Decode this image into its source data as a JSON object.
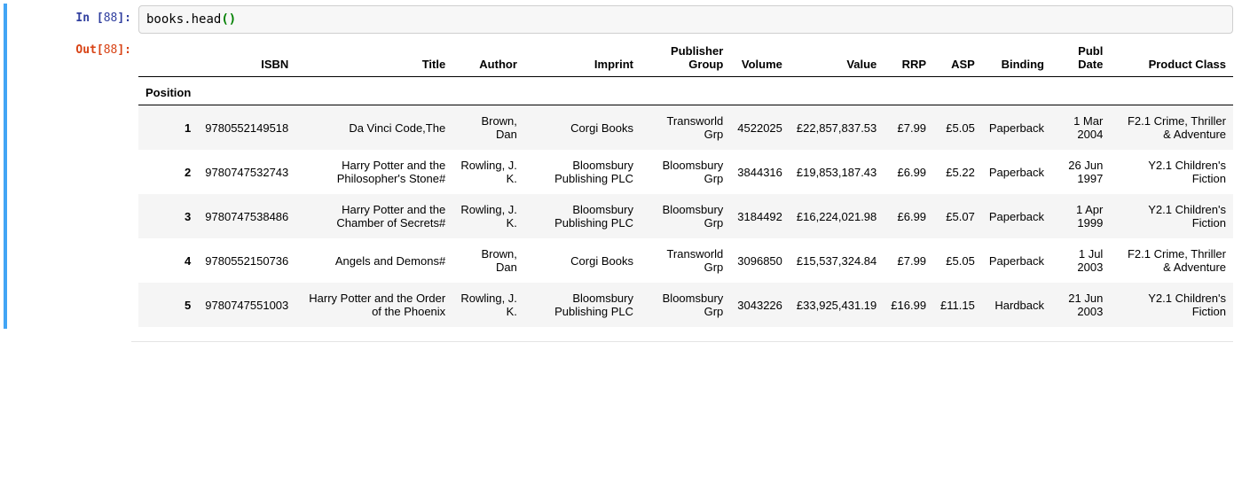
{
  "cell": {
    "in_label_prefix": "In [",
    "in_label_suffix": "]:",
    "out_label_prefix": "Out[",
    "out_label_suffix": "]:",
    "exec_count": "88",
    "code": {
      "obj": "books",
      "dot": ".",
      "func": "head",
      "paren_open": "(",
      "paren_close": ")"
    }
  },
  "table": {
    "index_name": "Position",
    "columns": [
      "ISBN",
      "Title",
      "Author",
      "Imprint",
      "Publisher Group",
      "Volume",
      "Value",
      "RRP",
      "ASP",
      "Binding",
      "Publ Date",
      "Product Class"
    ],
    "rows": [
      {
        "idx": "1",
        "ISBN": "9780552149518",
        "Title": "Da Vinci Code,The",
        "Author": "Brown, Dan",
        "Imprint": "Corgi Books",
        "Publisher Group": "Transworld Grp",
        "Volume": "4522025",
        "Value": "£22,857,837.53",
        "RRP": "£7.99",
        "ASP": "£5.05",
        "Binding": "Paperback",
        "Publ Date": "1 Mar 2004",
        "Product Class": "F2.1 Crime, Thriller & Adventure"
      },
      {
        "idx": "2",
        "ISBN": "9780747532743",
        "Title": "Harry Potter and the Philosopher's Stone#",
        "Author": "Rowling, J. K.",
        "Imprint": "Bloomsbury Publishing PLC",
        "Publisher Group": "Bloomsbury Grp",
        "Volume": "3844316",
        "Value": "£19,853,187.43",
        "RRP": "£6.99",
        "ASP": "£5.22",
        "Binding": "Paperback",
        "Publ Date": "26 Jun 1997",
        "Product Class": "Y2.1 Children's Fiction"
      },
      {
        "idx": "3",
        "ISBN": "9780747538486",
        "Title": "Harry Potter and the Chamber of Secrets#",
        "Author": "Rowling, J. K.",
        "Imprint": "Bloomsbury Publishing PLC",
        "Publisher Group": "Bloomsbury Grp",
        "Volume": "3184492",
        "Value": "£16,224,021.98",
        "RRP": "£6.99",
        "ASP": "£5.07",
        "Binding": "Paperback",
        "Publ Date": "1 Apr 1999",
        "Product Class": "Y2.1 Children's Fiction"
      },
      {
        "idx": "4",
        "ISBN": "9780552150736",
        "Title": "Angels and Demons#",
        "Author": "Brown, Dan",
        "Imprint": "Corgi Books",
        "Publisher Group": "Transworld Grp",
        "Volume": "3096850",
        "Value": "£15,537,324.84",
        "RRP": "£7.99",
        "ASP": "£5.05",
        "Binding": "Paperback",
        "Publ Date": "1 Jul 2003",
        "Product Class": "F2.1 Crime, Thriller & Adventure"
      },
      {
        "idx": "5",
        "ISBN": "9780747551003",
        "Title": "Harry Potter and the Order of the Phoenix",
        "Author": "Rowling, J. K.",
        "Imprint": "Bloomsbury Publishing PLC",
        "Publisher Group": "Bloomsbury Grp",
        "Volume": "3043226",
        "Value": "£33,925,431.19",
        "RRP": "£16.99",
        "ASP": "£11.15",
        "Binding": "Hardback",
        "Publ Date": "21 Jun 2003",
        "Product Class": "Y2.1 Children's Fiction"
      }
    ]
  }
}
